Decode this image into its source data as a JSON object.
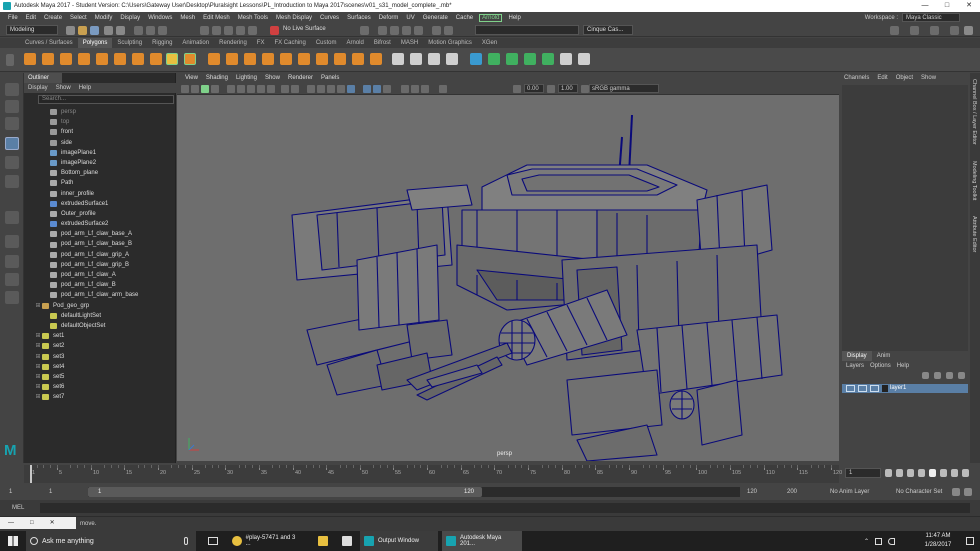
{
  "window": {
    "title": "Autodesk Maya 2017 - Student Version: C:\\Users\\Gateway User\\Desktop\\Pluralsight Lessons\\PL_Introduction to Maya 2017\\scenes\\v01_s31_model_complete_.mb*"
  },
  "menubar": {
    "items": [
      "File",
      "Edit",
      "Create",
      "Select",
      "Modify",
      "Display",
      "Windows",
      "Mesh",
      "Edit Mesh",
      "Mesh Tools",
      "Mesh Display",
      "Curves",
      "Surfaces",
      "Deform",
      "UV",
      "Generate",
      "Cache"
    ],
    "arnold": "Arnold",
    "help": "Help",
    "workspace_label": "Workspace :",
    "workspace_value": "Maya Classic"
  },
  "statusline": {
    "mode": "Modeling",
    "live_surface": "No Live Surface",
    "camera_combo": "Cinque Cas..."
  },
  "shelf": {
    "tabs": [
      "Curves / Surfaces",
      "Polygons",
      "Sculpting",
      "Rigging",
      "Animation",
      "Rendering",
      "FX",
      "FX Caching",
      "Custom",
      "Arnold",
      "Bifrost",
      "MASH",
      "Motion Graphics",
      "XGen"
    ],
    "active_tab": 1
  },
  "outliner": {
    "title": "Outliner",
    "menu": [
      "Display",
      "Show",
      "Help"
    ],
    "search_placeholder": "Search...",
    "items": [
      {
        "label": "persp",
        "dim": true,
        "icon": "camera-icon",
        "expand": false
      },
      {
        "label": "top",
        "dim": true,
        "icon": "camera-icon",
        "expand": false
      },
      {
        "label": "front",
        "dim": false,
        "icon": "camera-icon",
        "expand": false
      },
      {
        "label": "side",
        "dim": false,
        "icon": "camera-icon",
        "expand": false
      },
      {
        "label": "imagePlane1",
        "dim": false,
        "icon": "image-plane-icon",
        "expand": false
      },
      {
        "label": "imagePlane2",
        "dim": false,
        "icon": "image-plane-icon",
        "expand": false
      },
      {
        "label": "Bottom_plane",
        "dim": false,
        "icon": "curve-icon",
        "expand": false
      },
      {
        "label": "Path",
        "dim": false,
        "icon": "curve-icon",
        "expand": false
      },
      {
        "label": "inner_profile",
        "dim": false,
        "icon": "curve-icon",
        "expand": false
      },
      {
        "label": "extrudedSurface1",
        "dim": false,
        "icon": "surface-icon",
        "expand": false
      },
      {
        "label": "Outer_profile",
        "dim": false,
        "icon": "curve-icon",
        "expand": false
      },
      {
        "label": "extrudedSurface2",
        "dim": false,
        "icon": "surface-icon",
        "expand": false
      },
      {
        "label": "pod_arm_Lf_claw_base_A",
        "dim": false,
        "icon": "curve-icon",
        "expand": false
      },
      {
        "label": "pod_arm_Lf_claw_base_B",
        "dim": false,
        "icon": "curve-icon",
        "expand": false
      },
      {
        "label": "pod_arm_Lf_claw_grip_A",
        "dim": false,
        "icon": "curve-icon",
        "expand": false
      },
      {
        "label": "pod_arm_Lf_claw_grip_B",
        "dim": false,
        "icon": "curve-icon",
        "expand": false
      },
      {
        "label": "pod_arm_Lf_claw_A",
        "dim": false,
        "icon": "curve-icon",
        "expand": false
      },
      {
        "label": "pod_arm_Lf_claw_B",
        "dim": false,
        "icon": "curve-icon",
        "expand": false
      },
      {
        "label": "pod_arm_Lf_claw_arm_base",
        "dim": false,
        "icon": "curve-icon",
        "expand": false
      },
      {
        "label": "Pod_geo_grp",
        "dim": false,
        "icon": "group-icon",
        "expand": true
      },
      {
        "label": "defaultLightSet",
        "dim": false,
        "icon": "set-icon",
        "expand": false
      },
      {
        "label": "defaultObjectSet",
        "dim": false,
        "icon": "set-icon",
        "expand": false
      },
      {
        "label": "set1",
        "dim": false,
        "icon": "set-icon",
        "expand": true
      },
      {
        "label": "set2",
        "dim": false,
        "icon": "set-icon",
        "expand": true
      },
      {
        "label": "set3",
        "dim": false,
        "icon": "set-icon",
        "expand": true
      },
      {
        "label": "set4",
        "dim": false,
        "icon": "set-icon",
        "expand": true
      },
      {
        "label": "set5",
        "dim": false,
        "icon": "set-icon",
        "expand": true
      },
      {
        "label": "set6",
        "dim": false,
        "icon": "set-icon",
        "expand": true
      },
      {
        "label": "set7",
        "dim": false,
        "icon": "set-icon",
        "expand": true
      }
    ]
  },
  "viewport": {
    "menu": [
      "View",
      "Shading",
      "Lighting",
      "Show",
      "Renderer",
      "Panels"
    ],
    "exposure": "0.00",
    "gamma": "1.00",
    "color_space": "sRGB gamma",
    "camera_label": "persp"
  },
  "channelbox": {
    "menu": [
      "Channels",
      "Edit",
      "Object",
      "Show"
    ],
    "layer_tabs": [
      "Display",
      "Anim"
    ],
    "layer_menu": [
      "Layers",
      "Options",
      "Help"
    ],
    "layer_name": "layer1"
  },
  "side_tabs": [
    "Channel Box / Layer Editor",
    "Modeling Toolkit",
    "Attribute Editor"
  ],
  "timeslider": {
    "ticks": [
      "1",
      "5",
      "10",
      "15",
      "20",
      "25",
      "30",
      "35",
      "40",
      "45",
      "50",
      "55",
      "60",
      "65",
      "70",
      "75",
      "80",
      "85",
      "90",
      "95",
      "100",
      "105",
      "110",
      "115",
      "120"
    ],
    "current_frame": "1"
  },
  "rangeslider": {
    "start": "1",
    "start_inner": "1",
    "inner_start": "1",
    "inner_end": "120",
    "end_inner": "120",
    "end": "200",
    "anim_layer": "No Anim Layer",
    "char_set": "No Character Set"
  },
  "cmdline": {
    "label": "MEL"
  },
  "helpline": {
    "text": "move."
  },
  "taskbar": {
    "search": "Ask me anything",
    "apps": [
      "#play-57471 and 3 ...",
      "Output Window",
      "Autodesk Maya 201..."
    ],
    "time": "11:47 AM",
    "date": "1/28/2017"
  },
  "colors": {
    "wire": "#0a0a7a",
    "selection": "#5a7fa6",
    "accent": "#7fd18a",
    "maya_logo": "#17a3b0"
  }
}
